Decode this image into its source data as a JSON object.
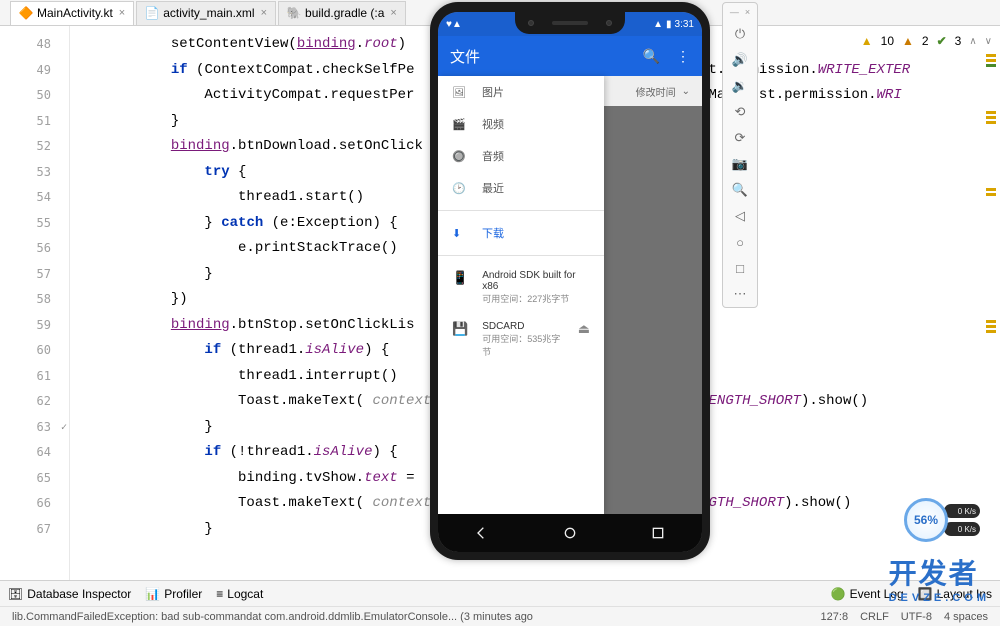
{
  "tabs": [
    {
      "label": "MainActivity.kt",
      "active": true,
      "icon": "kt"
    },
    {
      "label": "activity_main.xml",
      "active": false,
      "icon": "xml"
    },
    {
      "label": "build.gradle (:a",
      "active": false,
      "icon": "gradle"
    }
  ],
  "warnings": {
    "yellow_icon": "▲",
    "yellow": "10",
    "orange_icon": "▲",
    "orange": "2",
    "green_icon": "▲",
    "green": "3"
  },
  "gutter": {
    "start": 48,
    "end": 67,
    "check_at": 63
  },
  "code": {
    "48": {
      "indent": 12,
      "text": "setContentView(<ident>binding</ident>.<prop>root</prop>)"
    },
    "49": {
      "indent": 12,
      "text": "<kw>if</kw> (ContextCompat.checkSelfPe                              M  est.permission.<const>WRITE_EXTER</const>"
    },
    "50": {
      "indent": 16,
      "text": "ActivityCompat.requestPer                                 d.Manifest.permission.<const>WRI</const>"
    },
    "51": {
      "indent": 12,
      "text": "}"
    },
    "52": {
      "indent": 12,
      "text": "<ident>binding</ident>.btnDownload.setOnClick"
    },
    "53": {
      "indent": 16,
      "text": "<kw>try</kw> {"
    },
    "54": {
      "indent": 20,
      "text": "thread1.start()"
    },
    "55": {
      "indent": 16,
      "text": "} <kw>catch</kw> (e:Exception) {"
    },
    "56": {
      "indent": 20,
      "text": "e.printStackTrace()"
    },
    "57": {
      "indent": 16,
      "text": "}"
    },
    "58": {
      "indent": 12,
      "text": "})"
    },
    "59": {
      "indent": 12,
      "text": "<ident>binding</ident>.btnStop.setOnClickLis"
    },
    "60": {
      "indent": 16,
      "text": "<kw>if</kw> (thread1.<prop>isAlive</prop>) {"
    },
    "61": {
      "indent": 20,
      "text": "thread1.interrupt()"
    },
    "62": {
      "indent": 20,
      "text": "Toast.makeText( <param>context:</param>                             t.<const>LENGTH_SHORT</const>).show()"
    },
    "63": {
      "indent": 16,
      "text": "}"
    },
    "64": {
      "indent": 16,
      "text": "<kw>if</kw> (!thread1.<prop>isAlive</prop>) {"
    },
    "65": {
      "indent": 20,
      "text": "binding.tvShow.<prop>text</prop> ="
    },
    "66": {
      "indent": 20,
      "text": "Toast.makeText( <param>context:</param>                              <const>ENGTH_SHORT</const>).show()"
    },
    "67": {
      "indent": 16,
      "text": "}"
    }
  },
  "bottom_bar": {
    "db": "Database Inspector",
    "profiler": "Profiler",
    "logcat": "Logcat",
    "eventlog": "Event Log",
    "layout": "Layout Ins"
  },
  "status": {
    "left": "lib.CommandFailedException: bad sub-commandat com.android.ddmlib.EmulatorConsole... (3 minutes ago",
    "pos": "127:8",
    "eol": "CRLF",
    "enc": "UTF-8",
    "indent": "4 spaces"
  },
  "emulator": {
    "status_time": "3:31",
    "status_left": "♥▲",
    "app_title": "文件",
    "sub_bar": "修改时间",
    "drawer": [
      {
        "icon": "🖼",
        "label": "图片"
      },
      {
        "icon": "🎬",
        "label": "视频"
      },
      {
        "icon": "🔘",
        "label": "音频"
      },
      {
        "icon": "🕑",
        "label": "最近"
      }
    ],
    "download": {
      "icon": "⬇",
      "label": "下载"
    },
    "storage": [
      {
        "icon": "📱",
        "title": "Android SDK built for x86",
        "sub": "可用空间：227兆字节",
        "eject": false
      },
      {
        "icon": "💾",
        "title": "SDCARD",
        "sub": "可用空间：535兆字节",
        "eject": true
      }
    ]
  },
  "emu_toolbar": [
    "⏻",
    "🔊",
    "🔇",
    "◇",
    "◇",
    "📷",
    "📞",
    "◁",
    "○",
    "□",
    "⋯"
  ],
  "perf": {
    "pct": "56%",
    "b1": "0 K/s",
    "b2": "0 K/s"
  },
  "watermark": {
    "main": "开发者",
    "sub": "DEVZE.COM"
  }
}
